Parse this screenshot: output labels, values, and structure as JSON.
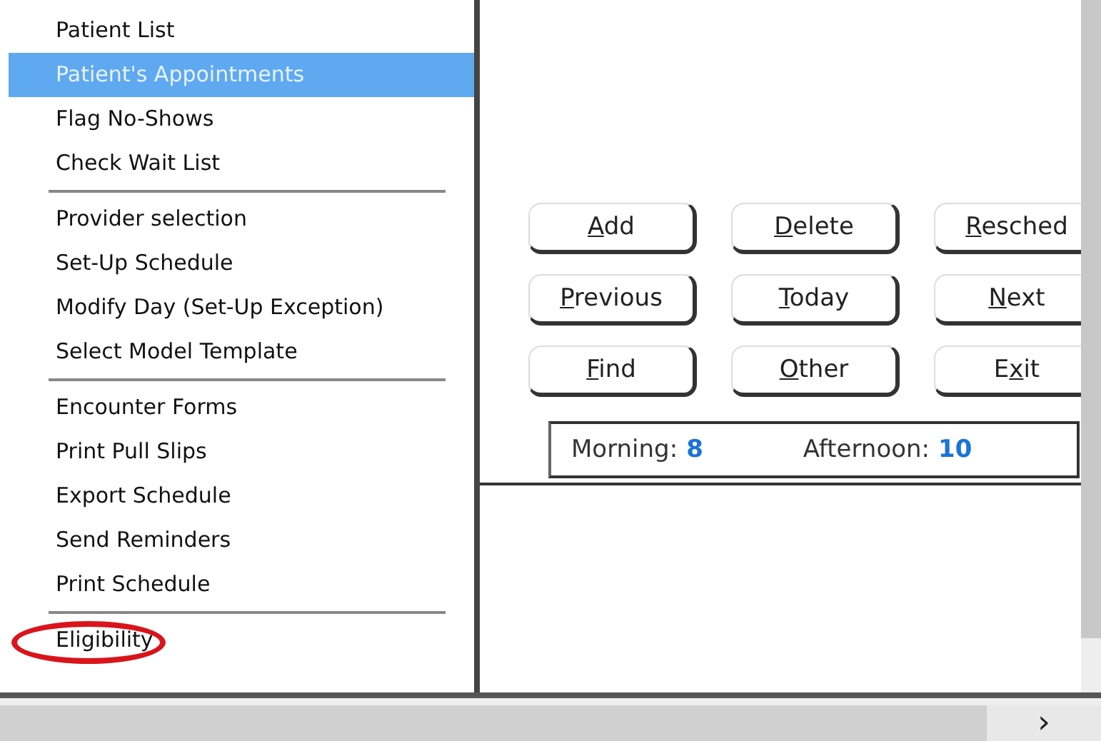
{
  "menu": {
    "groups": [
      {
        "items": [
          {
            "label": "Patient List",
            "selected": false,
            "circled": false
          },
          {
            "label": "Patient's Appointments",
            "selected": true,
            "circled": false
          },
          {
            "label": "Flag No-Shows",
            "selected": false,
            "circled": false
          },
          {
            "label": "Check Wait List",
            "selected": false,
            "circled": false
          }
        ]
      },
      {
        "items": [
          {
            "label": "Provider selection",
            "selected": false,
            "circled": false
          },
          {
            "label": "Set-Up Schedule",
            "selected": false,
            "circled": false
          },
          {
            "label": "Modify Day (Set-Up Exception)",
            "selected": false,
            "circled": false
          },
          {
            "label": "Select Model Template",
            "selected": false,
            "circled": false
          }
        ]
      },
      {
        "items": [
          {
            "label": "Encounter Forms",
            "selected": false,
            "circled": false
          },
          {
            "label": "Print Pull Slips",
            "selected": false,
            "circled": false
          },
          {
            "label": "Export Schedule",
            "selected": false,
            "circled": false
          },
          {
            "label": "Send Reminders",
            "selected": false,
            "circled": false
          },
          {
            "label": "Print Schedule",
            "selected": false,
            "circled": false
          }
        ]
      },
      {
        "items": [
          {
            "label": "Eligibility",
            "selected": false,
            "circled": true
          }
        ]
      }
    ]
  },
  "buttons": [
    {
      "parts": [
        {
          "text": "A",
          "underlined": true
        },
        {
          "text": "dd",
          "underlined": false
        }
      ]
    },
    {
      "parts": [
        {
          "text": "D",
          "underlined": true
        },
        {
          "text": "elete",
          "underlined": false
        }
      ]
    },
    {
      "parts": [
        {
          "text": "R",
          "underlined": true
        },
        {
          "text": "esched",
          "underlined": false
        }
      ]
    },
    {
      "parts": [
        {
          "text": "P",
          "underlined": true
        },
        {
          "text": "revious",
          "underlined": false
        }
      ]
    },
    {
      "parts": [
        {
          "text": "T",
          "underlined": true
        },
        {
          "text": "oday",
          "underlined": false
        }
      ]
    },
    {
      "parts": [
        {
          "text": "N",
          "underlined": true
        },
        {
          "text": "ext",
          "underlined": false
        }
      ]
    },
    {
      "parts": [
        {
          "text": "F",
          "underlined": true
        },
        {
          "text": "ind",
          "underlined": false
        }
      ]
    },
    {
      "parts": [
        {
          "text": "O",
          "underlined": true
        },
        {
          "text": "ther",
          "underlined": false
        }
      ]
    },
    {
      "parts": [
        {
          "text": "E",
          "underlined": false
        },
        {
          "text": "x",
          "underlined": true
        },
        {
          "text": "it",
          "underlined": false
        }
      ]
    }
  ],
  "counts": [
    {
      "label": "Morning:",
      "value": "8"
    },
    {
      "label": "Afternoon:",
      "value": "10"
    }
  ],
  "scrollbar": {
    "right_arrow": "›"
  }
}
